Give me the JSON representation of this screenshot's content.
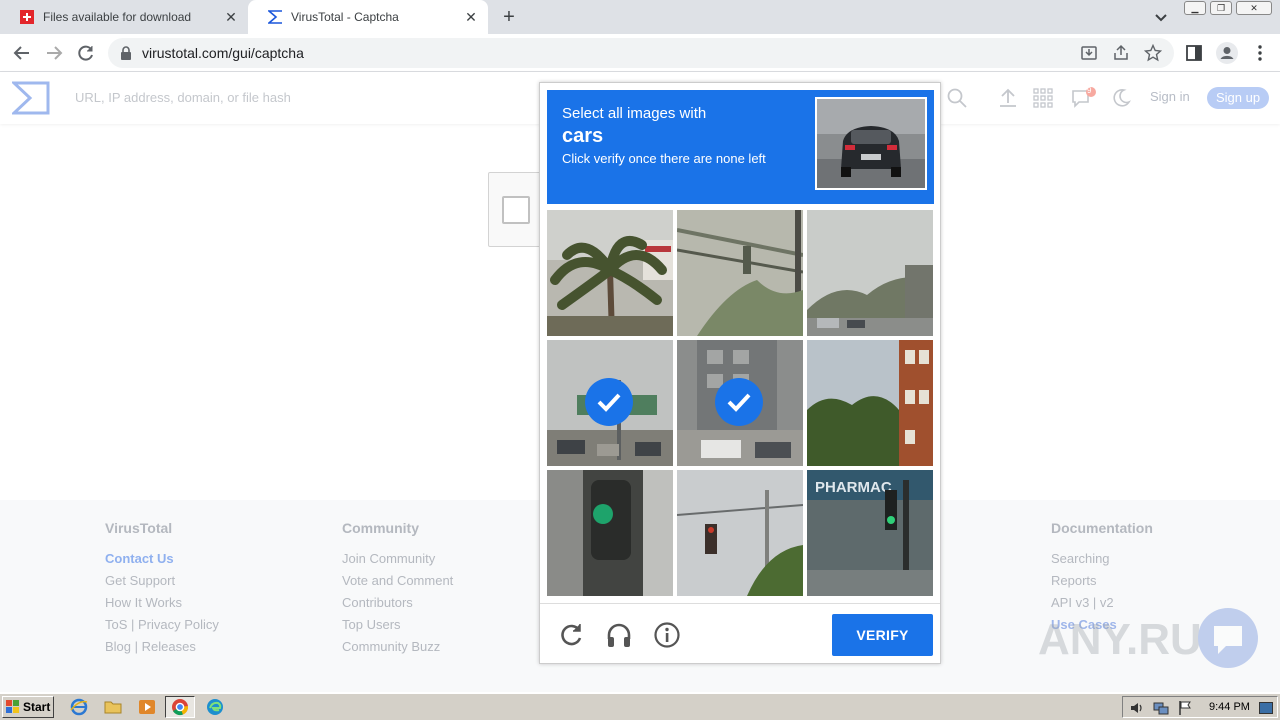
{
  "browser": {
    "tabs": [
      {
        "title": "Files available for download",
        "active": false
      },
      {
        "title": "VirusTotal - Captcha",
        "active": true
      }
    ],
    "url": "virustotal.com/gui/captcha"
  },
  "vt_header": {
    "search_placeholder": "URL, IP address, domain, or file hash",
    "notification_count": "9",
    "signin": "Sign in",
    "signup": "Sign up"
  },
  "captcha": {
    "line1": "Select all images with",
    "target": "cars",
    "line3": "Click verify once there are none left",
    "verify": "VERIFY",
    "selected_tiles": [
      4,
      5
    ]
  },
  "footer": {
    "columns": [
      {
        "heading": "VirusTotal",
        "links": [
          "Contact Us",
          "Get Support",
          "How It Works",
          "ToS | Privacy Policy",
          "Blog | Releases"
        ]
      },
      {
        "heading": "Community",
        "links": [
          "Join Community",
          "Vote and Comment",
          "Contributors",
          "Top Users",
          "Community Buzz"
        ]
      },
      {
        "heading": "Documentation",
        "links": [
          "Searching",
          "Reports",
          "API v3 | v2",
          "Use Cases"
        ]
      }
    ]
  },
  "watermark": "ANY.RUN",
  "taskbar": {
    "start": "Start",
    "clock": "9:44 PM"
  },
  "colors": {
    "captcha_blue": "#1a73e8",
    "vt_blue": "#b8ccf5"
  }
}
